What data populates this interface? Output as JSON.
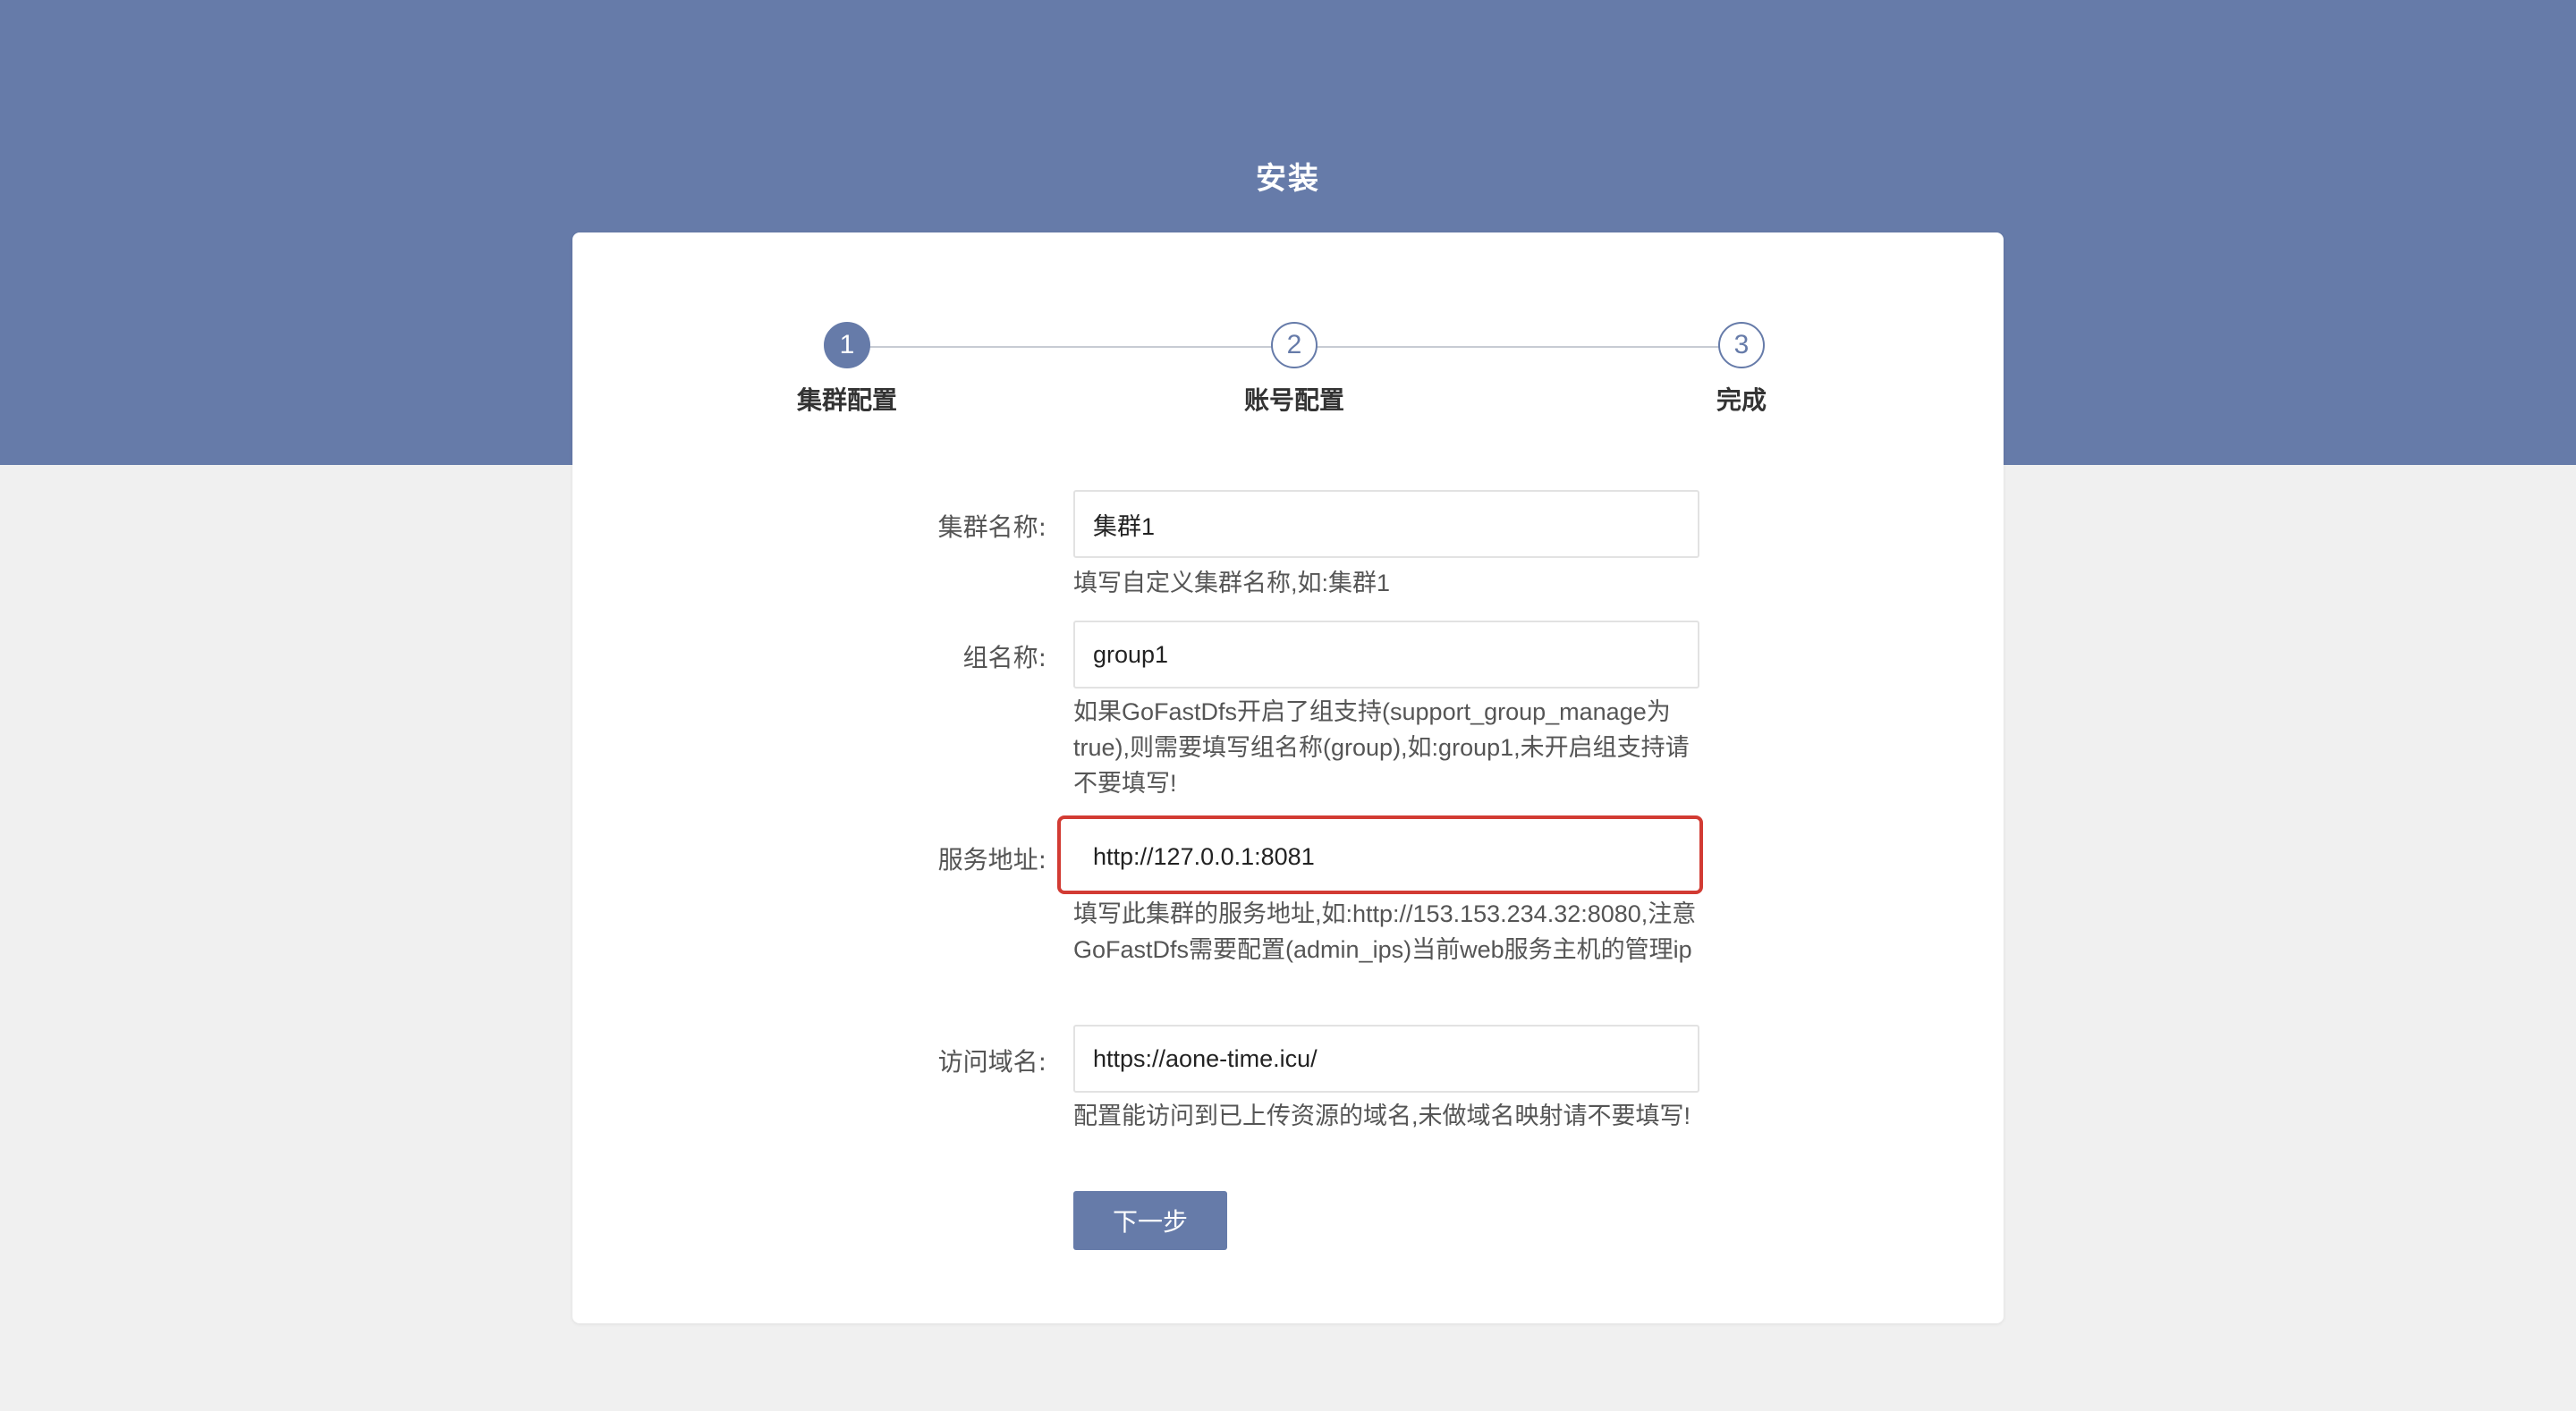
{
  "page": {
    "title": "安装"
  },
  "steps": [
    {
      "number": "1",
      "label": "集群配置",
      "state": "active"
    },
    {
      "number": "2",
      "label": "账号配置",
      "state": "pending"
    },
    {
      "number": "3",
      "label": "完成",
      "state": "pending"
    }
  ],
  "form": {
    "cluster_name": {
      "label": "集群名称:",
      "value": "集群1",
      "hint": "填写自定义集群名称,如:集群1"
    },
    "group_name": {
      "label": "组名称:",
      "value": "group1",
      "hint": "如果GoFastDfs开启了组支持(support_group_manage为true),则需要填写组名称(group),如:group1,未开启组支持请不要填写!"
    },
    "service_address": {
      "label": "服务地址:",
      "value": "http://127.0.0.1:8081",
      "hint": "填写此集群的服务地址,如:http://153.153.234.32:8080,注意GoFastDfs需要配置(admin_ips)当前web服务主机的管理ip",
      "highlighted": true
    },
    "access_domain": {
      "label": "访问域名:",
      "value": "https://aone-time.icu/",
      "hint": "配置能访问到已上传资源的域名,未做域名映射请不要填写!"
    },
    "next_button_label": "下一步"
  },
  "colors": {
    "primary": "#667ba9",
    "highlight": "#d23b33",
    "background": "#f0f0f0"
  }
}
